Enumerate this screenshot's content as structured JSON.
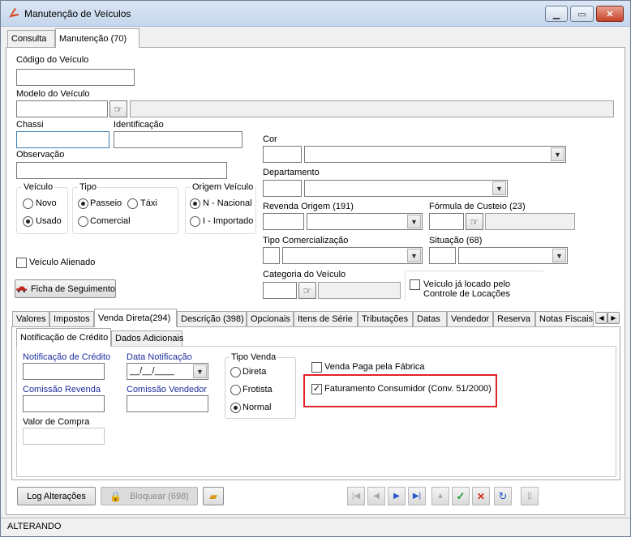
{
  "window": {
    "title": "Manutenção de Veículos"
  },
  "top_tabs": [
    {
      "label": "Consulta"
    },
    {
      "label": "Manutenção (70)"
    }
  ],
  "fields": {
    "codigo_veiculo": "Código do Veículo",
    "modelo_veiculo": "Modelo do Veículo",
    "chassi": "Chassi",
    "identificacao": "Identificação",
    "observacao": "Observação",
    "cor": "Cor",
    "departamento": "Departamento",
    "revenda_origem": "Revenda Origem (191)",
    "formula_custeio": "Fórmula de Custeio (23)",
    "tipo_comercializacao": "Tipo Comercialização",
    "situacao": "Situação (68)",
    "categoria_veiculo": "Categoria do Veículo"
  },
  "groups": {
    "veiculo": {
      "title": "Veículo",
      "options": [
        "Novo",
        "Usado"
      ],
      "selected": "Usado"
    },
    "tipo": {
      "title": "Tipo",
      "options": [
        "Passeio",
        "Táxi",
        "Comercial"
      ],
      "selected": "Passeio"
    },
    "origem": {
      "title": "Origem Veículo",
      "options": [
        "N - Nacional",
        "I - Importado"
      ],
      "selected": "N - Nacional"
    }
  },
  "checks": {
    "veiculo_alienado": "Veículo Alienado",
    "veiculo_locado": "Veículo já locado pelo Controle de Locações"
  },
  "buttons": {
    "ficha_seguimento": "Ficha de Seguimento",
    "log_alteracoes": "Log Alterações",
    "bloquear": "Bloquear (698)"
  },
  "lower_tabs": [
    {
      "label": "Valores"
    },
    {
      "label": "Impostos"
    },
    {
      "label": "Venda Direta(294)"
    },
    {
      "label": "Descrição (398)"
    },
    {
      "label": "Opcionais"
    },
    {
      "label": "Itens de Série"
    },
    {
      "label": "Tributações"
    },
    {
      "label": "Datas"
    },
    {
      "label": "Vendedor"
    },
    {
      "label": "Reserva"
    },
    {
      "label": "Notas Fiscais"
    }
  ],
  "sub_tabs": [
    {
      "label": "Notificação de Crédito"
    },
    {
      "label": "Dados Adicionais"
    }
  ],
  "venda": {
    "notificacao_credito": "Notificação de Crédito",
    "data_notificacao": "Data Notificação",
    "data_mask": "__/__/____",
    "comissao_revenda": "Comissão Revenda",
    "comissao_vendedor": "Comissão Vendedor",
    "valor_compra": "Valor de Compra",
    "tipo_venda": {
      "title": "Tipo Venda",
      "options": [
        "Direta",
        "Frotista",
        "Normal"
      ],
      "selected": "Normal"
    },
    "venda_paga_fabrica": "Venda Paga pela Fábrica",
    "faturamento_consumidor": "Faturamento Consumidor (Conv. 51/2000)"
  },
  "status": {
    "text": "ALTERANDO"
  },
  "colors": {
    "highlight": "#e0222a",
    "blue_label": "#1c2e9c"
  }
}
